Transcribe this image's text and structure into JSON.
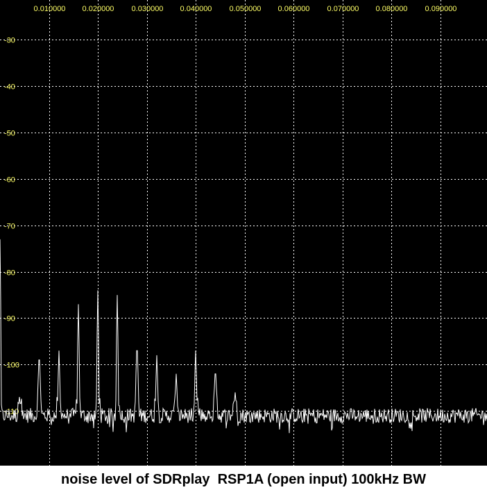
{
  "caption": "noise level of SDRplay  RSP1A (open input) 100kHz BW",
  "colors": {
    "background": "#000000",
    "grid": "#ffffff",
    "trace": "#ffffff",
    "tick_label": "#ffff66"
  },
  "chart_data": {
    "type": "line",
    "title": "noise level of SDRplay  RSP1A (open input) 100kHz BW",
    "xlabel": "",
    "ylabel": "",
    "xlim": [
      0,
      0.0995
    ],
    "ylim": [
      -121.8,
      -21.4
    ],
    "grid": true,
    "x_tick_labels": [
      "0.010000",
      "0.020000",
      "0.030000",
      "0.040000",
      "0.050000",
      "0.060000",
      "0.070000",
      "0.080000",
      "0.090000"
    ],
    "x_ticks": [
      0.01,
      0.02,
      0.03,
      0.04,
      0.05,
      0.06,
      0.07,
      0.08,
      0.09
    ],
    "y_tick_labels": [
      "-30",
      "-40",
      "-50",
      "-60",
      "-70",
      "-80",
      "-90",
      "-100",
      "-110"
    ],
    "y_ticks": [
      -30,
      -40,
      -50,
      -60,
      -70,
      -80,
      -90,
      -100,
      -110
    ],
    "noise_floor": -111,
    "peaks": [
      {
        "x": 0.0,
        "y": -73
      },
      {
        "x": 0.004,
        "y": -107
      },
      {
        "x": 0.008,
        "y": -99
      },
      {
        "x": 0.012,
        "y": -97
      },
      {
        "x": 0.016,
        "y": -87
      },
      {
        "x": 0.02,
        "y": -84
      },
      {
        "x": 0.024,
        "y": -85
      },
      {
        "x": 0.028,
        "y": -97
      },
      {
        "x": 0.032,
        "y": -98
      },
      {
        "x": 0.036,
        "y": -102
      },
      {
        "x": 0.04,
        "y": -97
      },
      {
        "x": 0.044,
        "y": -102
      },
      {
        "x": 0.048,
        "y": -106
      }
    ]
  }
}
